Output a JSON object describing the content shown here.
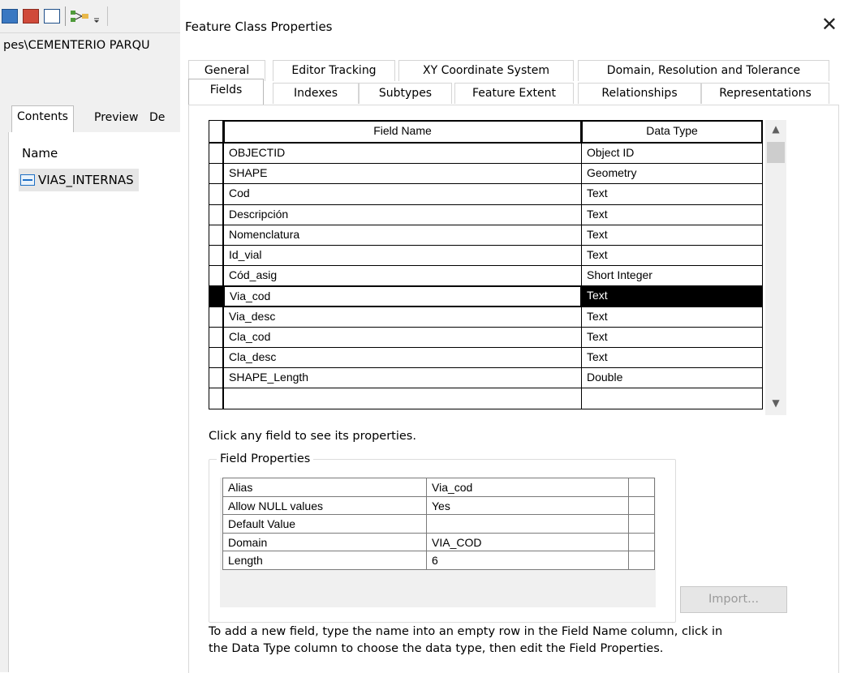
{
  "app": {
    "path_text": "pes\\CEMENTERIO PARQU",
    "tabs": [
      "Contents",
      "Preview",
      "De"
    ],
    "name_header": "Name",
    "layer_name": "VIAS_INTERNAS"
  },
  "dialog": {
    "title": "Feature Class Properties",
    "close_symbol": "✕",
    "tabs_row1": [
      "General",
      "Editor Tracking",
      "XY Coordinate System",
      "Domain, Resolution and Tolerance"
    ],
    "tabs_row2": [
      "Fields",
      "Indexes",
      "Subtypes",
      "Feature Extent",
      "Relationships",
      "Representations"
    ],
    "active_tab": "Fields",
    "grid": {
      "headers": {
        "field_name": "Field Name",
        "data_type": "Data Type"
      },
      "selected_row": 7,
      "rows": [
        {
          "field_name": "OBJECTID",
          "data_type": "Object ID"
        },
        {
          "field_name": "SHAPE",
          "data_type": "Geometry"
        },
        {
          "field_name": "Cod",
          "data_type": "Text"
        },
        {
          "field_name": "Descripción",
          "data_type": "Text"
        },
        {
          "field_name": "Nomenclatura",
          "data_type": "Text"
        },
        {
          "field_name": "Id_vial",
          "data_type": "Text"
        },
        {
          "field_name": "Cód_asig",
          "data_type": "Short Integer"
        },
        {
          "field_name": "Via_cod",
          "data_type": "Text"
        },
        {
          "field_name": "Via_desc",
          "data_type": "Text"
        },
        {
          "field_name": "Cla_cod",
          "data_type": "Text"
        },
        {
          "field_name": "Cla_desc",
          "data_type": "Text"
        },
        {
          "field_name": "SHAPE_Length",
          "data_type": "Double"
        },
        {
          "field_name": "",
          "data_type": ""
        }
      ]
    },
    "hint": "Click any field to see its properties.",
    "field_properties": {
      "legend": "Field Properties",
      "rows": [
        {
          "label": "Alias",
          "value": "Via_cod"
        },
        {
          "label": "Allow NULL values",
          "value": "Yes"
        },
        {
          "label": "Default Value",
          "value": ""
        },
        {
          "label": "Domain",
          "value": "VIA_COD"
        },
        {
          "label": "Length",
          "value": "6"
        }
      ]
    },
    "import_label": "Import...",
    "footer_line1": "To add a new field, type the name into an empty row in the Field Name column, click in",
    "footer_line2": "the Data Type column to choose the data type, then edit the Field Properties."
  },
  "colors": {
    "selection": "#000000",
    "accent": "#1e6fc4"
  }
}
